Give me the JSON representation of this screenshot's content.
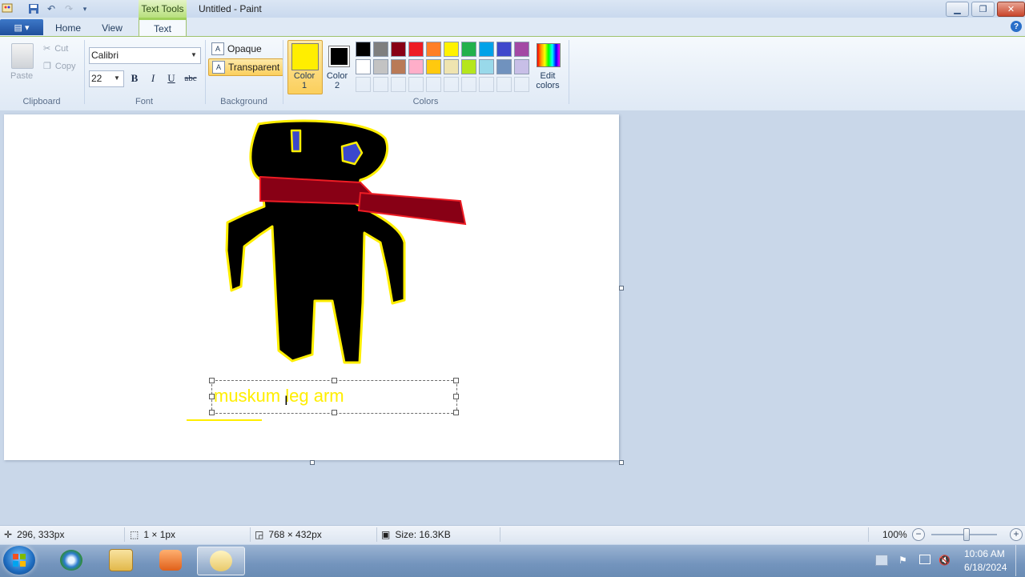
{
  "window": {
    "title": "Untitled - Paint",
    "contextual_tab": "Text Tools",
    "controls": [
      "minimize",
      "maximize",
      "close"
    ]
  },
  "tabs": [
    "Home",
    "View",
    "Text"
  ],
  "active_tab": "Text",
  "clipboard": {
    "paste": "Paste",
    "cut": "Cut",
    "copy": "Copy",
    "label": "Clipboard"
  },
  "font": {
    "family": "Calibri",
    "size": "22",
    "label": "Font",
    "bold": "B",
    "italic": "I",
    "underline": "U",
    "strikethrough": "abc"
  },
  "background": {
    "opaque": "Opaque",
    "transparent": "Transparent",
    "label": "Background",
    "selected": "Transparent"
  },
  "colors": {
    "label": "Colors",
    "color1_label": "Color\n1",
    "color1_l1": "Color",
    "color1_l2": "1",
    "color2_l1": "Color",
    "color2_l2": "2",
    "color1": "#ffee00",
    "color2": "#000000",
    "edit_l1": "Edit",
    "edit_l2": "colors",
    "palette": [
      "#000000",
      "#7f7f7f",
      "#880015",
      "#ed1c24",
      "#ff7f27",
      "#fff200",
      "#22b14c",
      "#00a2e8",
      "#3f48cc",
      "#a349a4",
      "#ffffff",
      "#c3c3c3",
      "#b97a57",
      "#ffaec9",
      "#ffc90e",
      "#efe4b0",
      "#b5e61d",
      "#99d9ea",
      "#7092be",
      "#c8bfe7"
    ],
    "empty_slots": 10
  },
  "canvas": {
    "text_content": "muskum leg arm",
    "text_color": "#ffee00"
  },
  "status": {
    "cursor_pos": "296, 333px",
    "selection_size": "1 × 1px",
    "canvas_size": "768 × 432px",
    "file_size": "Size: 16.3KB",
    "zoom": "100%"
  },
  "taskbar": {
    "time": "10:06 AM",
    "date": "6/18/2024",
    "apps": [
      "start-orb",
      "internet-browser",
      "file-explorer",
      "media-player",
      "paint"
    ],
    "active_app": "paint"
  }
}
